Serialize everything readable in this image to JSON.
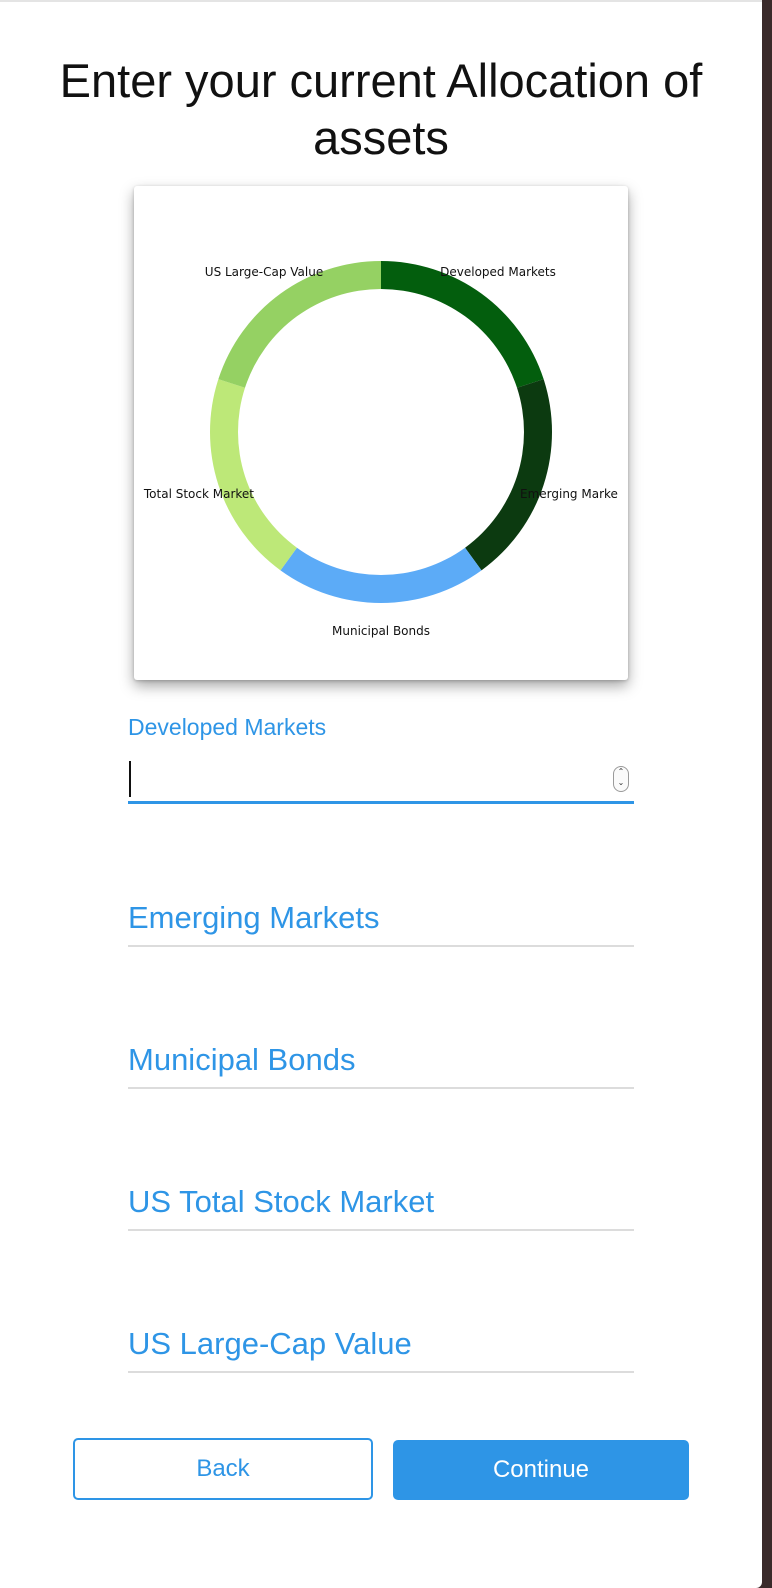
{
  "header": {
    "title": "Enter your current Allocation of assets"
  },
  "chart_data": {
    "type": "pie",
    "donut": true,
    "categories": [
      "Developed Markets",
      "Emerging Markets",
      "Municipal Bonds",
      "US Total Stock Market",
      "US Large-Cap Value"
    ],
    "values": [
      20,
      20,
      20,
      20,
      20
    ],
    "colors": [
      "#035e0d",
      "#0c3a10",
      "#5cabf7",
      "#bde878",
      "#95d163"
    ],
    "labels_shown": [
      "Developed Markets",
      "Emerging Marke",
      "Municipal Bonds",
      "Total Stock Market",
      "US Large-Cap Value"
    ]
  },
  "form": {
    "fields": [
      {
        "label": "Developed Markets",
        "value": "",
        "state": "focused"
      },
      {
        "label": "Emerging Markets",
        "value": ""
      },
      {
        "label": "Municipal Bonds",
        "value": ""
      },
      {
        "label": "US Total Stock Market",
        "value": ""
      },
      {
        "label": "US Large-Cap Value",
        "value": ""
      }
    ]
  },
  "actions": {
    "back_label": "Back",
    "continue_label": "Continue"
  },
  "colors": {
    "accent": "#2e95e6"
  }
}
